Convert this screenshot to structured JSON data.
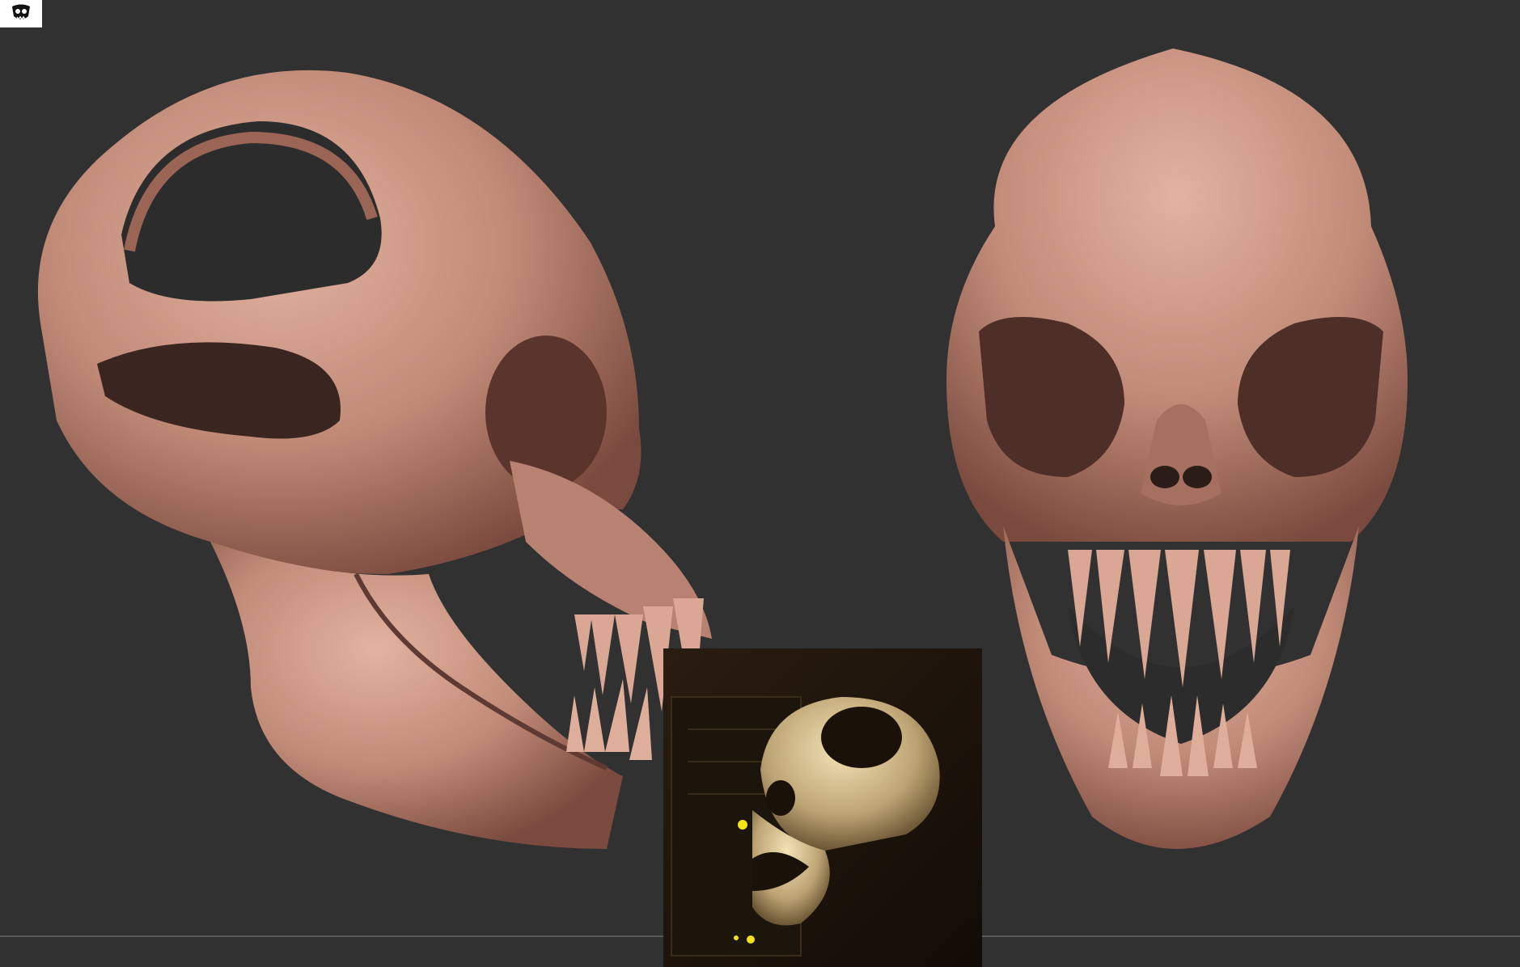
{
  "app": {
    "icon_name": "skull-logo-icon"
  },
  "canvas": {
    "background": "#313131",
    "clay_color": "#c08a77",
    "clay_shadow": "#7a4a3e",
    "clay_highlight": "#e2b3a0"
  },
  "views": [
    {
      "name": "side-view-skull-sculpt"
    },
    {
      "name": "front-view-skull-sculpt"
    },
    {
      "name": "reference-render-thumbnail"
    }
  ]
}
